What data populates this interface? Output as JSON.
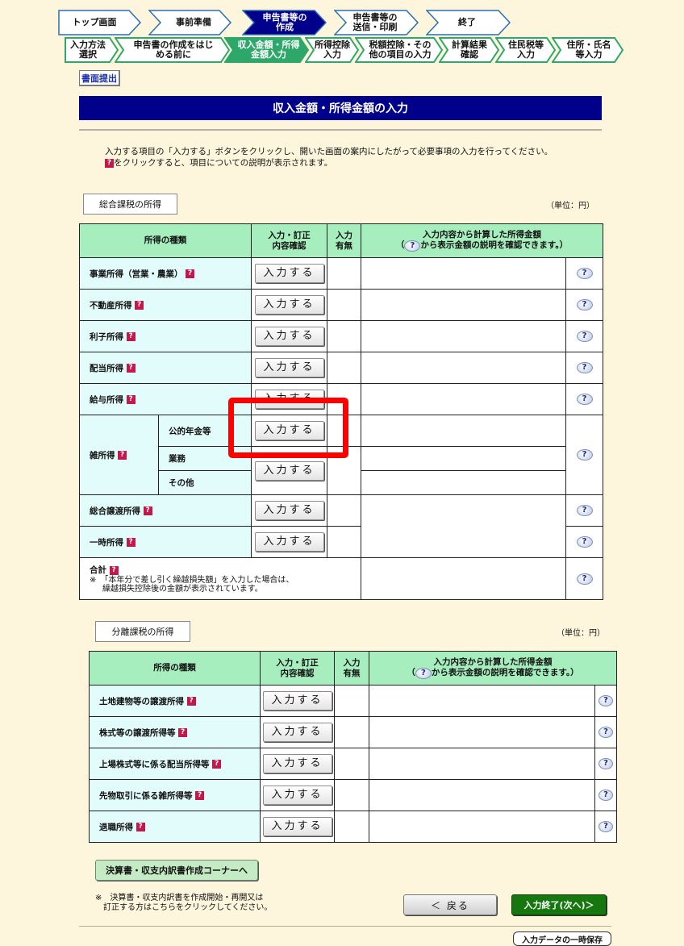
{
  "steps_top": [
    {
      "label": "トップ画面",
      "active": false
    },
    {
      "label": "事前準備",
      "active": false
    },
    {
      "label": "申告書等の\n作成",
      "active": true
    },
    {
      "label": "申告書等の\n送信・印刷",
      "active": false
    },
    {
      "label": "終了",
      "active": false
    }
  ],
  "steps_sub": [
    {
      "label": "入力方法\n選択",
      "active": false
    },
    {
      "label": "申告書の作成をはじ\nめる前に",
      "active": false
    },
    {
      "label": "収入金額・所得\n金額入力",
      "active": true
    },
    {
      "label": "所得控除\n入力",
      "active": false
    },
    {
      "label": "税額控除・その\n他の項目の入力",
      "active": false
    },
    {
      "label": "計算結果\n確認",
      "active": false
    },
    {
      "label": "住民税等\n入力",
      "active": false
    },
    {
      "label": "住所・氏名\n等入力",
      "active": false
    }
  ],
  "submit_label": "書面提出",
  "page_title": "収入金額・所得金額の入力",
  "instructions": {
    "line1": "入力する項目の「入力する」ボタンをクリックし、開いた画面の案内にしたがって必要事項の入力を行ってください。",
    "line2": "をクリックすると、項目についての説明が表示されます。"
  },
  "q_icon": "?",
  "help_icon": "?",
  "input_button_label": "入力する",
  "sogo": {
    "section_label": "総合課税の所得",
    "unit": "（単位：円）",
    "headers": {
      "type": "所得の種類",
      "confirm": "入力・訂正\n内容確認",
      "presence": "入力\n有無",
      "amount_line1": "入力内容から計算した所得金額",
      "amount_line2": "から表示金額の説明を確認できます。）",
      "amount_paren": "（"
    },
    "rows": {
      "jigyo": "事業所得（営業・農業）",
      "fudosan": "不動産所得",
      "rishi": "利子所得",
      "haito": "配当所得",
      "kyuyo": "給与所得",
      "zatsu": "雑所得",
      "zatsu_kouteki": "公的年金等",
      "zatsu_gyomu": "業務",
      "zatsu_sonota": "その他",
      "sogo_joto": "総合譲渡所得",
      "ichiji": "一時所得",
      "gokei": "合計",
      "gokei_note1": "※　「本年分で差し引く繰越損失額」を入力した場合は、",
      "gokei_note2": "繰越損失控除後の金額が表示されています。"
    }
  },
  "bunri": {
    "section_label": "分離課税の所得",
    "unit": "（単位：円）",
    "rows": {
      "tochi": "土地建物等の譲渡所得",
      "kabushiki": "株式等の譲渡所得等",
      "jojo": "上場株式等に係る配当所得等",
      "sakimono": "先物取引に係る雑所得等",
      "taishoku": "退職所得"
    }
  },
  "kessan_label": "決算書・収支内訳書作成コーナーへ",
  "bottom_note_line1": "※　決算書・収支内訳書を作成開始・再開又は",
  "bottom_note_line2": "訂正する方はこちらをクリックしてください。",
  "back_label": "＜ 戻る",
  "next_label": "入力終了(次へ)＞",
  "save_label": "入力データの一時保存",
  "colors": {
    "active_step": "#00008b",
    "sub_step": "#2ea86a",
    "header_green": "#a6eebe",
    "label_cyan": "#e2fbfb",
    "highlight": "#ff0000"
  }
}
